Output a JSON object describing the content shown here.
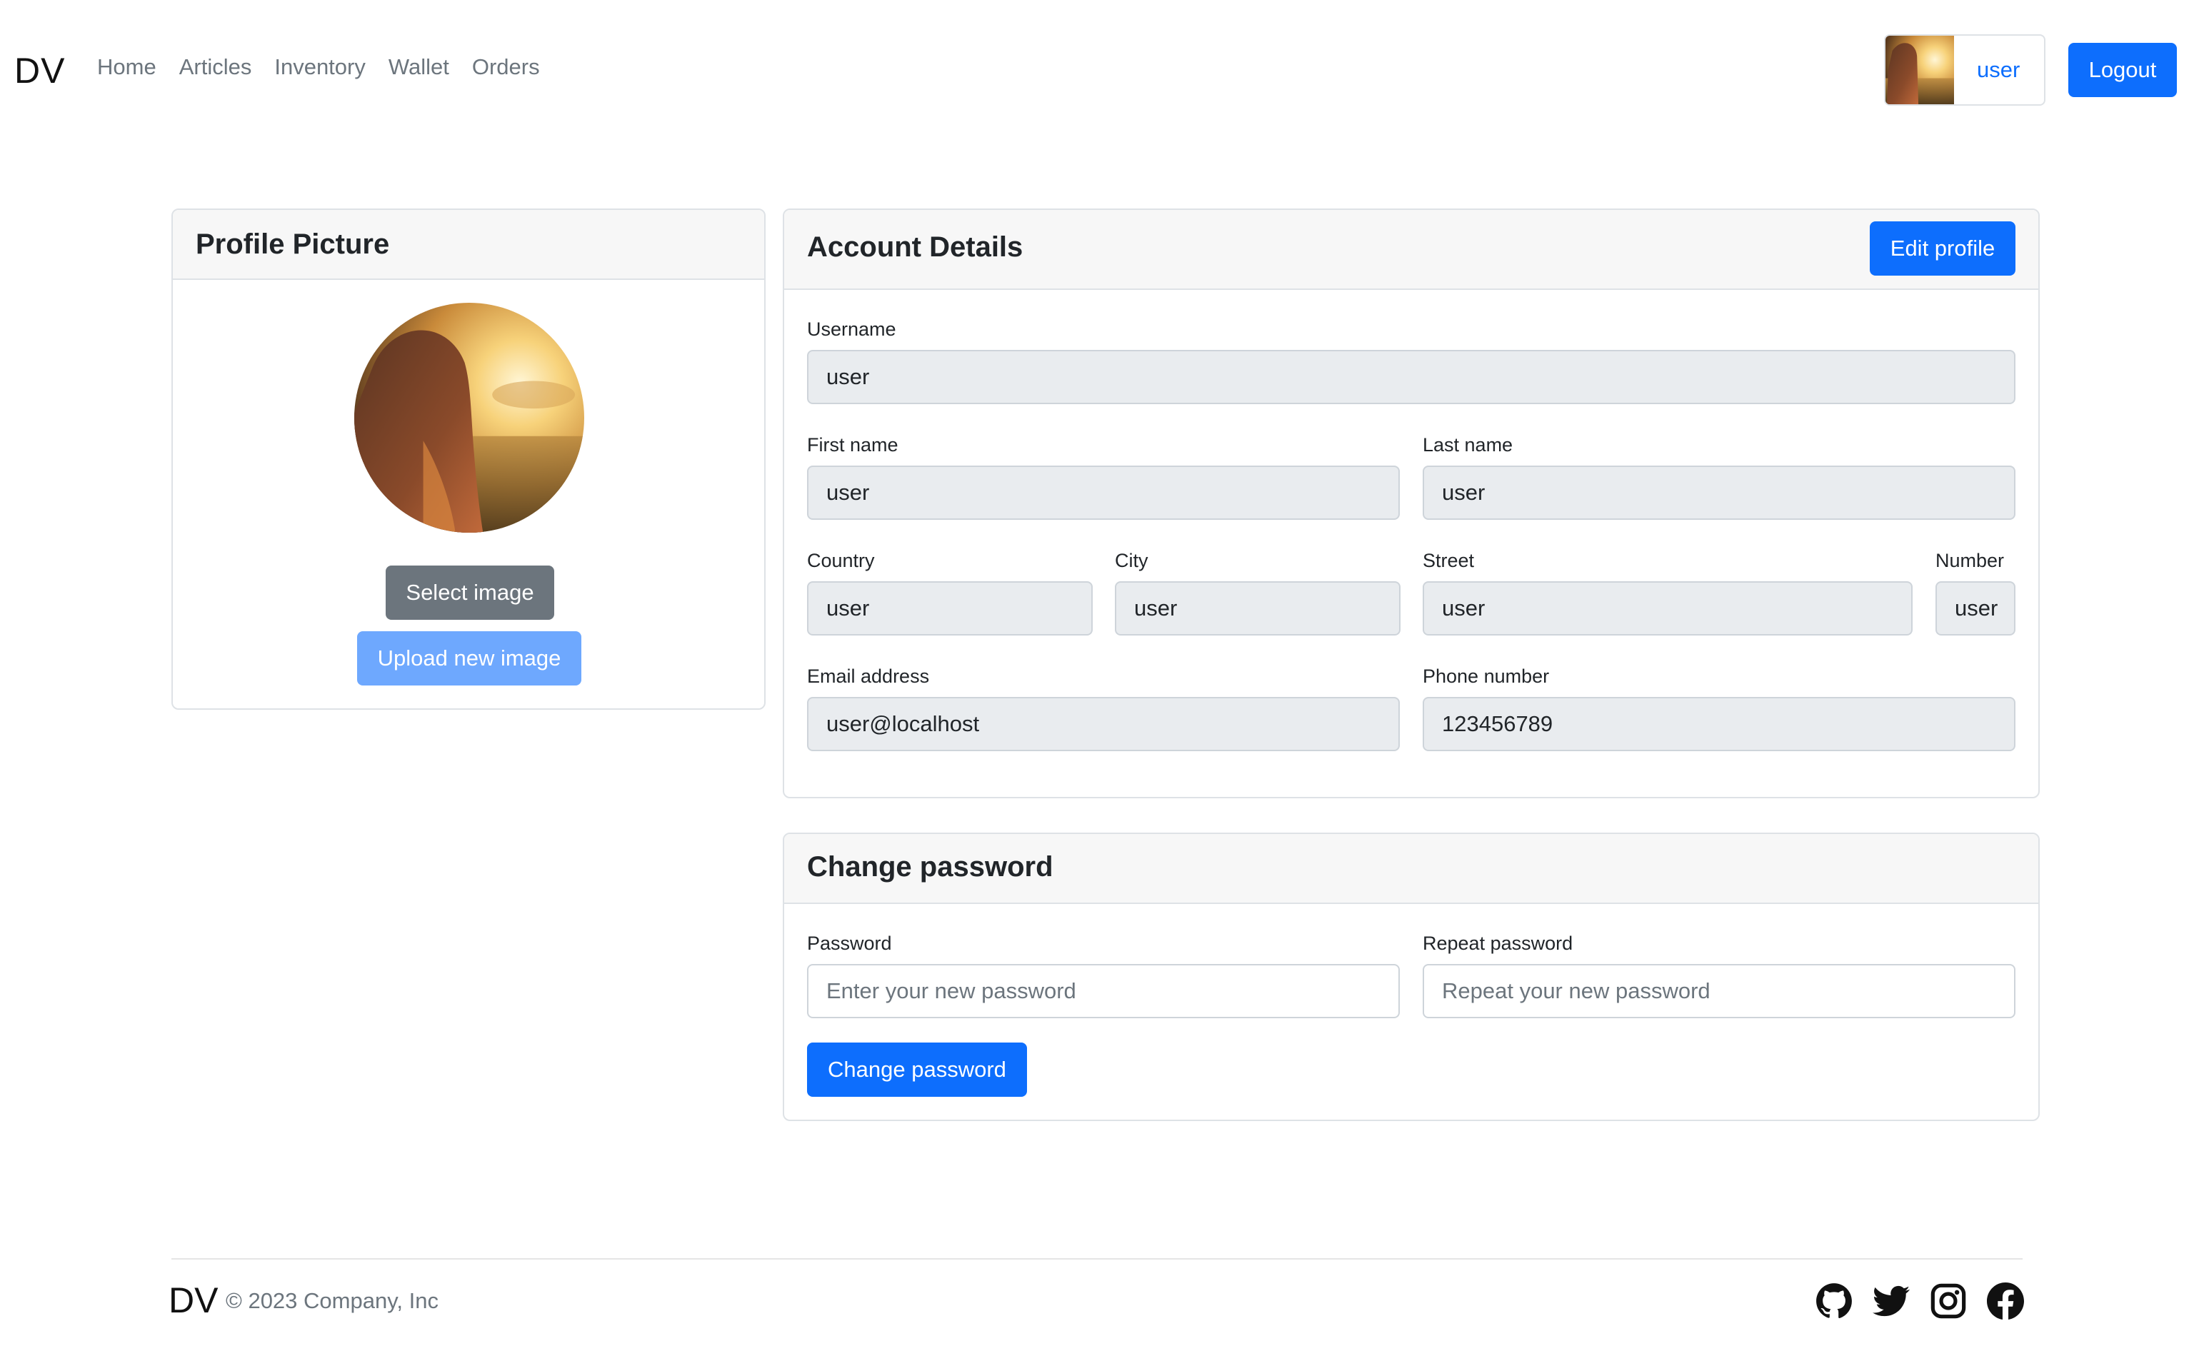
{
  "navbar": {
    "brand": "DV",
    "links": [
      "Home",
      "Articles",
      "Inventory",
      "Wallet",
      "Orders"
    ],
    "user_name": "user",
    "logout_label": "Logout"
  },
  "profile_picture": {
    "title": "Profile Picture",
    "select_label": "Select image",
    "upload_label": "Upload new image"
  },
  "account": {
    "title": "Account Details",
    "edit_label": "Edit profile",
    "username_label": "Username",
    "username": "user",
    "first_name_label": "First name",
    "first_name": "user",
    "last_name_label": "Last name",
    "last_name": "user",
    "country_label": "Country",
    "country": "user",
    "city_label": "City",
    "city": "user",
    "street_label": "Street",
    "street": "user",
    "number_label": "Number",
    "number": "user",
    "email_label": "Email address",
    "email": "user@localhost",
    "phone_label": "Phone number",
    "phone": "123456789"
  },
  "password": {
    "title": "Change password",
    "password_label": "Password",
    "password_placeholder": "Enter your new password",
    "repeat_label": "Repeat password",
    "repeat_placeholder": "Repeat your new password",
    "submit_label": "Change password"
  },
  "footer": {
    "brand": "DV",
    "copyright": "© 2023 Company, Inc",
    "social_icons": [
      "github-icon",
      "twitter-icon",
      "instagram-icon",
      "facebook-icon"
    ]
  },
  "colors": {
    "primary": "#0d6efd",
    "secondary": "#6c757d",
    "primary_disabled": "#6ea8fe",
    "input_disabled_bg": "#e9ecef"
  }
}
